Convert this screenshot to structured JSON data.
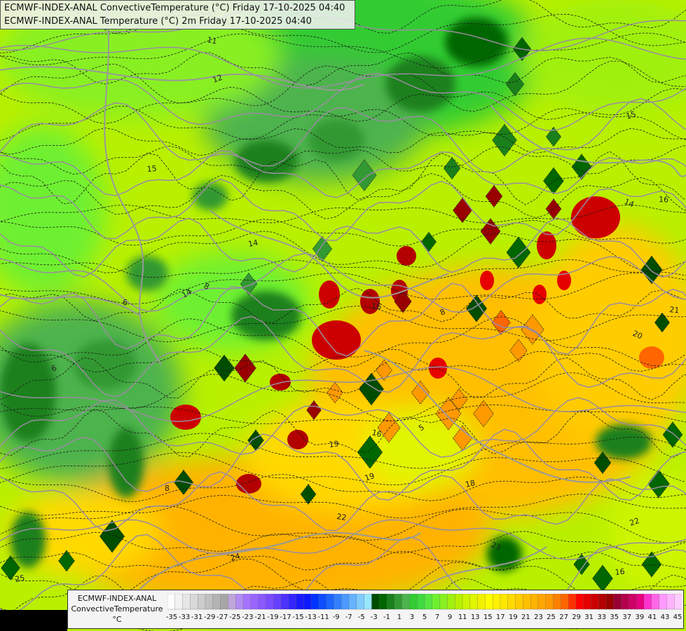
{
  "header": {
    "line1": "ECMWF-INDEX-ANAL ConvectiveTemperature (°C) Friday 17-10-2025 04:40",
    "line2": "ECMWF-INDEX-ANAL Temperature (°C) 2m Friday 17-10-2025 04:40"
  },
  "legend": {
    "label_line1": "ECMWF-INDEX-ANAL",
    "label_line2": "ConvectiveTemperature",
    "unit": "°C",
    "tick_labels": [
      "-35",
      "-33",
      "-31",
      "-29",
      "-27",
      "-25",
      "-23",
      "-21",
      "-19",
      "-17",
      "-15",
      "-13",
      "-11",
      "-9",
      "-7",
      "-5",
      "-3",
      "-1",
      "1",
      "3",
      "5",
      "7",
      "9",
      "11",
      "13",
      "15",
      "17",
      "19",
      "21",
      "23",
      "25",
      "27",
      "29",
      "31",
      "33",
      "35",
      "37",
      "39",
      "41",
      "43",
      "45"
    ],
    "colors": [
      "#ffffff",
      "#f2f2f2",
      "#e6e6e6",
      "#d9d9d9",
      "#cccccc",
      "#c0c0c0",
      "#b3b3b3",
      "#a6a6a6",
      "#bfa6d9",
      "#b38cf2",
      "#a673ff",
      "#9966ff",
      "#8c59ff",
      "#7a4cff",
      "#6640ff",
      "#4d33ff",
      "#3326ff",
      "#1a1aff",
      "#0d1aff",
      "#0033ff",
      "#0d4dff",
      "#1a66ff",
      "#3380ff",
      "#4d99ff",
      "#66b3ff",
      "#80ccff",
      "#99e6ff",
      "#004d00",
      "#006600",
      "#1a801a",
      "#339933",
      "#4db34d",
      "#33cc33",
      "#40d940",
      "#55e640",
      "#6ef030",
      "#88f020",
      "#a0f010",
      "#b8f000",
      "#cdf500",
      "#e0f500",
      "#f0f000",
      "#ffff00",
      "#fff200",
      "#ffe600",
      "#ffd900",
      "#ffcc00",
      "#ffbf00",
      "#ffb300",
      "#ffa600",
      "#ff9900",
      "#ff8000",
      "#ff6600",
      "#ff3300",
      "#ff0000",
      "#e60000",
      "#cc0000",
      "#b30000",
      "#990000",
      "#990033",
      "#b3004d",
      "#cc0066",
      "#e60080",
      "#ff33cc",
      "#ff66e6",
      "#ff99ff",
      "#ffb3ff",
      "#ffccff"
    ]
  },
  "contour_labels": [
    "11",
    "12",
    "15",
    "16",
    "14",
    "14",
    "8",
    "6",
    "5",
    "19",
    "19",
    "22",
    "24",
    "16",
    "18",
    "20",
    "21",
    "16",
    "23",
    "22",
    "25",
    "15",
    "14",
    "16",
    "8",
    "6",
    "8"
  ]
}
